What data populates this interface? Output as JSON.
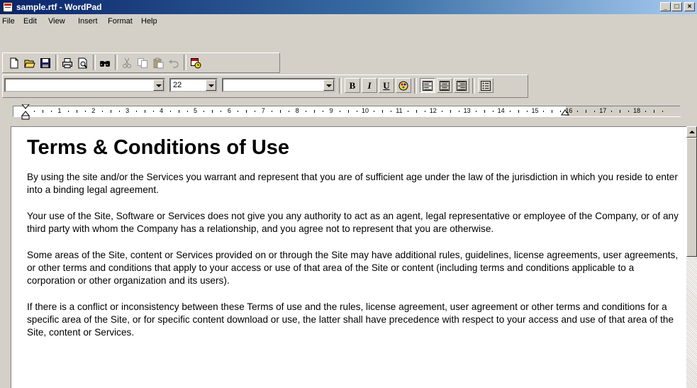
{
  "window": {
    "title": "sample.rtf - WordPad"
  },
  "menu": [
    "File",
    "Edit",
    "View",
    "Insert",
    "Format",
    "Help"
  ],
  "toolbar": {
    "buttons": [
      "new-doc",
      "open-folder",
      "save",
      "print",
      "print-preview",
      "find",
      "cut",
      "copy",
      "paste",
      "undo",
      "insert-date-time"
    ]
  },
  "format_bar": {
    "font_name": "",
    "font_size": "22",
    "script": "",
    "bold": "B",
    "italic": "I",
    "underline": "U"
  },
  "ruler": {
    "numbers": [
      "1",
      "2",
      "3",
      "4",
      "5",
      "6",
      "7",
      "8",
      "9",
      "10",
      "11",
      "12",
      "13",
      "14",
      "15",
      "16",
      "17",
      "18"
    ]
  },
  "document": {
    "heading": "Terms & Conditions of Use",
    "paragraphs": [
      "By using the site and/or the Services you warrant and represent that you are of sufficient age under the law of the jurisdiction in which you reside to enter into a binding legal agreement.",
      "Your use of the Site, Software or Services does not give you any authority to act as an agent, legal representative or employee of the Company, or of any third party with whom the Company has a relationship, and you agree not to represent that you are otherwise.",
      "Some areas of the Site, content or Services provided on or through the Site may have additional rules, guidelines, license agreements, user agreements, or other terms and conditions that apply to your access or use of that area of the Site or content (including terms and conditions applicable to a corporation or other organization and its users).",
      "If there is a conflict or inconsistency between these Terms of use and the rules, license agreement, user agreement or other terms and conditions for a specific area of the Site, or for specific content download or use, the latter shall have precedence with respect to your access and use of that area of the Site, content or Services."
    ]
  }
}
